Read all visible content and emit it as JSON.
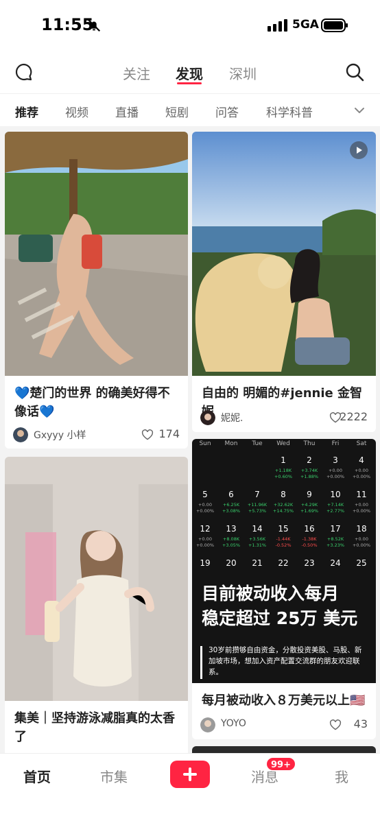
{
  "status_bar": {
    "time": "11:55",
    "network": "5GA"
  },
  "top_nav": {
    "tabs": [
      {
        "label": "关注",
        "active": false
      },
      {
        "label": "发现",
        "active": true
      },
      {
        "label": "深圳",
        "active": false
      }
    ]
  },
  "categories": [
    "推荐",
    "视频",
    "直播",
    "短剧",
    "问答",
    "科学科普"
  ],
  "feed": {
    "card1": {
      "title": "💙楚门的世界 的确美好得不像话💙",
      "author": "Gxyyy 小样",
      "likes": "174"
    },
    "card2": {
      "title": "自由的 明媚的#jennie 金智妮",
      "author": "妮妮.",
      "likes": "2222"
    },
    "card3": {
      "title": "集美｜坚持游泳减脂真的太香了"
    },
    "card4": {
      "title": "每月被动收入８万美元以上🇺🇸",
      "author": "YOYO",
      "likes": "43",
      "image_headline_line1": "目前被动收入每月",
      "image_headline_line2": "稳定超过 25万 美元",
      "image_body": "30岁前攒够自由资金，分散投资美股、马股、新加坡市场，想加入资产配置交流群的朋友欢迎联系。",
      "calendar": {
        "weekdays": [
          "Sun",
          "Mon",
          "Tue",
          "Wed",
          "Thu",
          "Fri",
          "Sat"
        ],
        "weeks": [
          [
            null,
            null,
            null,
            {
              "d": "1",
              "a": "+1.18K",
              "p": "+0.60%",
              "s": "pos"
            },
            {
              "d": "2",
              "a": "+3.74K",
              "p": "+1.88%",
              "s": "pos"
            },
            {
              "d": "3",
              "a": "+0.00",
              "p": "+0.00%",
              "s": "neu"
            },
            {
              "d": "4",
              "a": "+0.00",
              "p": "+0.00%",
              "s": "neu"
            }
          ],
          [
            {
              "d": "5",
              "a": "+0.00",
              "p": "+0.00%",
              "s": "neu"
            },
            {
              "d": "6",
              "a": "+6.25K",
              "p": "+3.08%",
              "s": "pos"
            },
            {
              "d": "7",
              "a": "+11.96K",
              "p": "+5.73%",
              "s": "pos"
            },
            {
              "d": "8",
              "a": "+32.62K",
              "p": "+14.75%",
              "s": "pos"
            },
            {
              "d": "9",
              "a": "+4.29K",
              "p": "+1.69%",
              "s": "pos"
            },
            {
              "d": "10",
              "a": "+7.14K",
              "p": "+2.77%",
              "s": "pos"
            },
            {
              "d": "11",
              "a": "+0.00",
              "p": "+0.00%",
              "s": "neu"
            }
          ],
          [
            {
              "d": "12",
              "a": "+0.00",
              "p": "+0.00%",
              "s": "neu"
            },
            {
              "d": "13",
              "a": "+8.08K",
              "p": "+3.05%",
              "s": "pos"
            },
            {
              "d": "14",
              "a": "+3.56K",
              "p": "+1.31%",
              "s": "pos"
            },
            {
              "d": "15",
              "a": "-1.44K",
              "p": "-0.52%",
              "s": "neg"
            },
            {
              "d": "16",
              "a": "-1.38K",
              "p": "-0.50%",
              "s": "neg"
            },
            {
              "d": "17",
              "a": "+8.52K",
              "p": "+3.23%",
              "s": "pos"
            },
            {
              "d": "18",
              "a": "+0.00",
              "p": "+0.00%",
              "s": "neu"
            }
          ],
          [
            {
              "d": "19"
            },
            {
              "d": "20"
            },
            {
              "d": "21"
            },
            {
              "d": "22"
            },
            {
              "d": "23"
            },
            {
              "d": "24"
            },
            {
              "d": "25"
            }
          ]
        ]
      }
    }
  },
  "bottom_tabs": {
    "home": "首页",
    "market": "市集",
    "messages": "消息",
    "messages_badge": "99+",
    "me": "我"
  },
  "colors": {
    "brand": "#ff2442",
    "gain": "#3ad06c",
    "loss": "#ff4d4d"
  }
}
